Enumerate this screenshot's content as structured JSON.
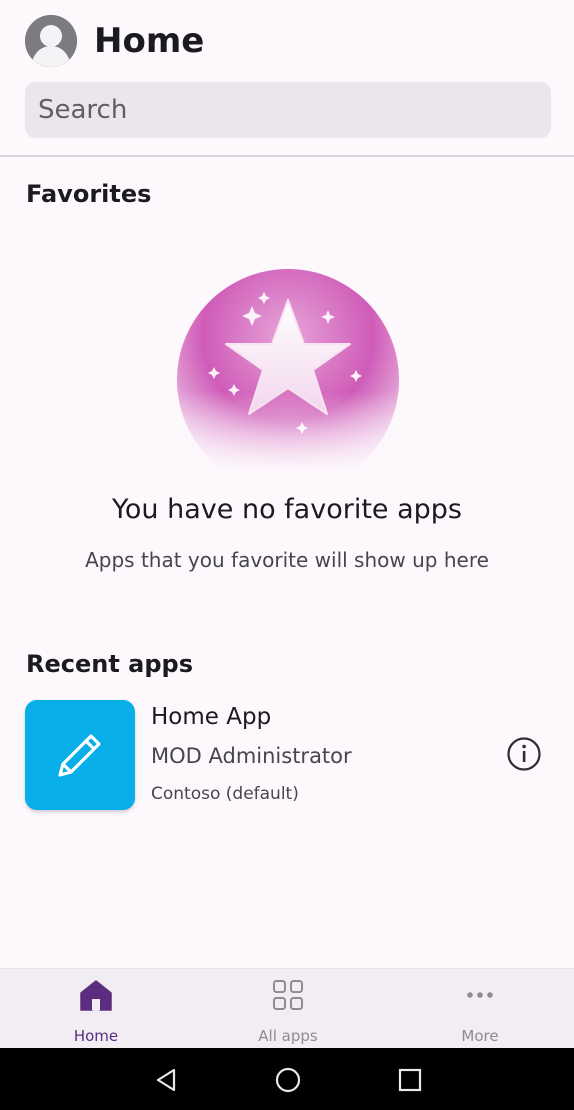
{
  "header": {
    "title": "Home",
    "search_placeholder": "Search"
  },
  "favorites": {
    "title": "Favorites",
    "empty_title": "You have no favorite apps",
    "empty_subtitle": "Apps that you favorite will show up here"
  },
  "recent": {
    "title": "Recent apps",
    "apps": [
      {
        "name": "Home App",
        "owner": "MOD Administrator",
        "environment": "Contoso (default)",
        "tile_color": "#07aee8",
        "icon": "pencil-icon"
      }
    ]
  },
  "bottom_nav": {
    "items": [
      {
        "label": "Home",
        "icon": "home-icon",
        "active": true
      },
      {
        "label": "All apps",
        "icon": "grid-icon",
        "active": false
      },
      {
        "label": "More",
        "icon": "more-icon",
        "active": false
      }
    ]
  },
  "colors": {
    "accent": "#5c2d7e",
    "background": "#fdf8fc",
    "app_tile": "#07aee8"
  }
}
